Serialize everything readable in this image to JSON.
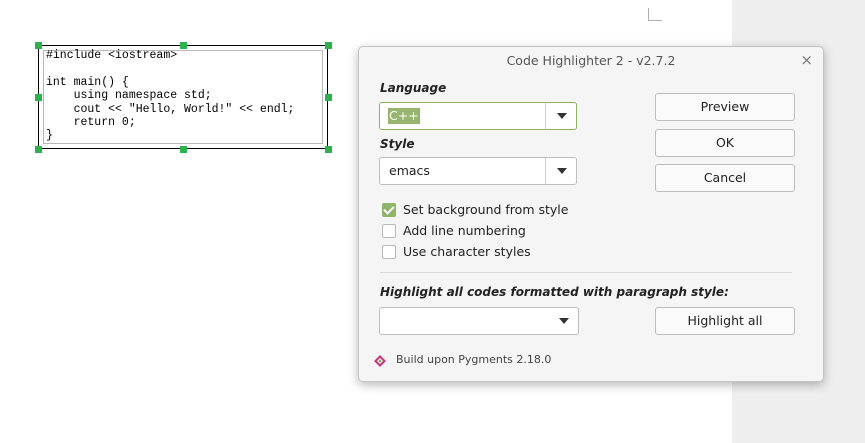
{
  "document": {
    "code_lines": [
      "#include <iostream>",
      "",
      "int main() {",
      "    using namespace std;",
      "    cout << \"Hello, World!\" << endl;",
      "    return 0;",
      "}"
    ]
  },
  "dialog": {
    "title": "Code Highlighter 2 - v2.7.2",
    "close_glyph": "×",
    "language": {
      "label": "Language",
      "value": "C++"
    },
    "style": {
      "label": "Style",
      "value": "emacs"
    },
    "checkboxes": [
      {
        "label": "Set background from style",
        "checked": true
      },
      {
        "label": "Add line numbering",
        "checked": false
      },
      {
        "label": "Use character styles",
        "checked": false
      }
    ],
    "buttons": {
      "preview": "Preview",
      "ok": "OK",
      "cancel": "Cancel",
      "highlight_all": "Highlight all"
    },
    "paragraph_style": {
      "label": "Highlight all codes formatted with paragraph style:",
      "value": ""
    },
    "footer": {
      "text": "Build upon Pygments 2.18.0",
      "icon": "pygments-logo-icon"
    },
    "colors": {
      "accent": "#8fb46a",
      "selection": "#97b56f",
      "handle": "#2bb24c"
    }
  }
}
